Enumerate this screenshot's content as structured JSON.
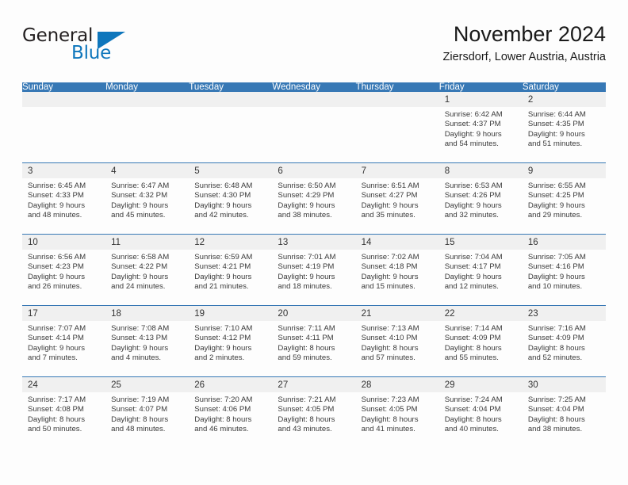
{
  "brand": {
    "word1": "General",
    "word2": "Blue",
    "accent_color": "#0e76bc",
    "triangle_icon": "brand-triangle-icon"
  },
  "header": {
    "title": "November 2024",
    "subtitle": "Ziersdorf, Lower Austria, Austria"
  },
  "calendar": {
    "header_color": "#3778b5",
    "datebar_color": "#f0f0f0",
    "weekday_headers": [
      "Sunday",
      "Monday",
      "Tuesday",
      "Wednesday",
      "Thursday",
      "Friday",
      "Saturday"
    ],
    "weeks": [
      [
        {
          "day": "",
          "lines": []
        },
        {
          "day": "",
          "lines": []
        },
        {
          "day": "",
          "lines": []
        },
        {
          "day": "",
          "lines": []
        },
        {
          "day": "",
          "lines": []
        },
        {
          "day": "1",
          "lines": [
            "Sunrise: 6:42 AM",
            "Sunset: 4:37 PM",
            "Daylight: 9 hours",
            "and 54 minutes."
          ]
        },
        {
          "day": "2",
          "lines": [
            "Sunrise: 6:44 AM",
            "Sunset: 4:35 PM",
            "Daylight: 9 hours",
            "and 51 minutes."
          ]
        }
      ],
      [
        {
          "day": "3",
          "lines": [
            "Sunrise: 6:45 AM",
            "Sunset: 4:33 PM",
            "Daylight: 9 hours",
            "and 48 minutes."
          ]
        },
        {
          "day": "4",
          "lines": [
            "Sunrise: 6:47 AM",
            "Sunset: 4:32 PM",
            "Daylight: 9 hours",
            "and 45 minutes."
          ]
        },
        {
          "day": "5",
          "lines": [
            "Sunrise: 6:48 AM",
            "Sunset: 4:30 PM",
            "Daylight: 9 hours",
            "and 42 minutes."
          ]
        },
        {
          "day": "6",
          "lines": [
            "Sunrise: 6:50 AM",
            "Sunset: 4:29 PM",
            "Daylight: 9 hours",
            "and 38 minutes."
          ]
        },
        {
          "day": "7",
          "lines": [
            "Sunrise: 6:51 AM",
            "Sunset: 4:27 PM",
            "Daylight: 9 hours",
            "and 35 minutes."
          ]
        },
        {
          "day": "8",
          "lines": [
            "Sunrise: 6:53 AM",
            "Sunset: 4:26 PM",
            "Daylight: 9 hours",
            "and 32 minutes."
          ]
        },
        {
          "day": "9",
          "lines": [
            "Sunrise: 6:55 AM",
            "Sunset: 4:25 PM",
            "Daylight: 9 hours",
            "and 29 minutes."
          ]
        }
      ],
      [
        {
          "day": "10",
          "lines": [
            "Sunrise: 6:56 AM",
            "Sunset: 4:23 PM",
            "Daylight: 9 hours",
            "and 26 minutes."
          ]
        },
        {
          "day": "11",
          "lines": [
            "Sunrise: 6:58 AM",
            "Sunset: 4:22 PM",
            "Daylight: 9 hours",
            "and 24 minutes."
          ]
        },
        {
          "day": "12",
          "lines": [
            "Sunrise: 6:59 AM",
            "Sunset: 4:21 PM",
            "Daylight: 9 hours",
            "and 21 minutes."
          ]
        },
        {
          "day": "13",
          "lines": [
            "Sunrise: 7:01 AM",
            "Sunset: 4:19 PM",
            "Daylight: 9 hours",
            "and 18 minutes."
          ]
        },
        {
          "day": "14",
          "lines": [
            "Sunrise: 7:02 AM",
            "Sunset: 4:18 PM",
            "Daylight: 9 hours",
            "and 15 minutes."
          ]
        },
        {
          "day": "15",
          "lines": [
            "Sunrise: 7:04 AM",
            "Sunset: 4:17 PM",
            "Daylight: 9 hours",
            "and 12 minutes."
          ]
        },
        {
          "day": "16",
          "lines": [
            "Sunrise: 7:05 AM",
            "Sunset: 4:16 PM",
            "Daylight: 9 hours",
            "and 10 minutes."
          ]
        }
      ],
      [
        {
          "day": "17",
          "lines": [
            "Sunrise: 7:07 AM",
            "Sunset: 4:14 PM",
            "Daylight: 9 hours",
            "and 7 minutes."
          ]
        },
        {
          "day": "18",
          "lines": [
            "Sunrise: 7:08 AM",
            "Sunset: 4:13 PM",
            "Daylight: 9 hours",
            "and 4 minutes."
          ]
        },
        {
          "day": "19",
          "lines": [
            "Sunrise: 7:10 AM",
            "Sunset: 4:12 PM",
            "Daylight: 9 hours",
            "and 2 minutes."
          ]
        },
        {
          "day": "20",
          "lines": [
            "Sunrise: 7:11 AM",
            "Sunset: 4:11 PM",
            "Daylight: 8 hours",
            "and 59 minutes."
          ]
        },
        {
          "day": "21",
          "lines": [
            "Sunrise: 7:13 AM",
            "Sunset: 4:10 PM",
            "Daylight: 8 hours",
            "and 57 minutes."
          ]
        },
        {
          "day": "22",
          "lines": [
            "Sunrise: 7:14 AM",
            "Sunset: 4:09 PM",
            "Daylight: 8 hours",
            "and 55 minutes."
          ]
        },
        {
          "day": "23",
          "lines": [
            "Sunrise: 7:16 AM",
            "Sunset: 4:09 PM",
            "Daylight: 8 hours",
            "and 52 minutes."
          ]
        }
      ],
      [
        {
          "day": "24",
          "lines": [
            "Sunrise: 7:17 AM",
            "Sunset: 4:08 PM",
            "Daylight: 8 hours",
            "and 50 minutes."
          ]
        },
        {
          "day": "25",
          "lines": [
            "Sunrise: 7:19 AM",
            "Sunset: 4:07 PM",
            "Daylight: 8 hours",
            "and 48 minutes."
          ]
        },
        {
          "day": "26",
          "lines": [
            "Sunrise: 7:20 AM",
            "Sunset: 4:06 PM",
            "Daylight: 8 hours",
            "and 46 minutes."
          ]
        },
        {
          "day": "27",
          "lines": [
            "Sunrise: 7:21 AM",
            "Sunset: 4:05 PM",
            "Daylight: 8 hours",
            "and 43 minutes."
          ]
        },
        {
          "day": "28",
          "lines": [
            "Sunrise: 7:23 AM",
            "Sunset: 4:05 PM",
            "Daylight: 8 hours",
            "and 41 minutes."
          ]
        },
        {
          "day": "29",
          "lines": [
            "Sunrise: 7:24 AM",
            "Sunset: 4:04 PM",
            "Daylight: 8 hours",
            "and 40 minutes."
          ]
        },
        {
          "day": "30",
          "lines": [
            "Sunrise: 7:25 AM",
            "Sunset: 4:04 PM",
            "Daylight: 8 hours",
            "and 38 minutes."
          ]
        }
      ]
    ]
  }
}
